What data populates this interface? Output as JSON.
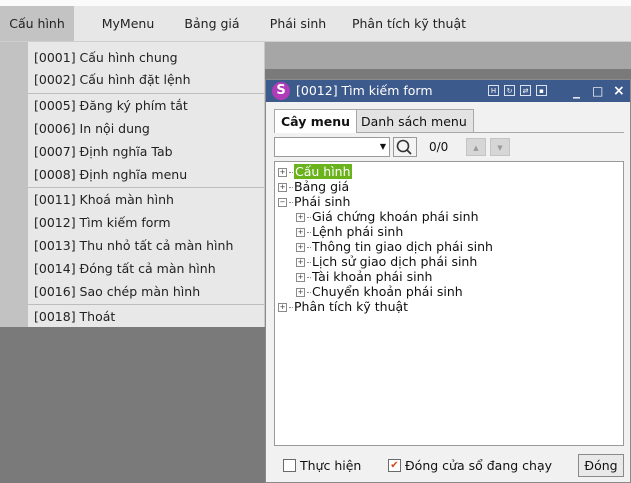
{
  "menubar": {
    "items": [
      {
        "label": "Cấu hình"
      },
      {
        "label": "MyMenu"
      },
      {
        "label": "Bảng giá"
      },
      {
        "label": "Phái sinh"
      },
      {
        "label": "Phân tích kỹ thuật"
      }
    ]
  },
  "dropdown": {
    "items": [
      {
        "label": "[0001] Cấu hình chung"
      },
      {
        "label": "[0002] Cấu hình đặt lệnh"
      },
      {
        "label": "[0005] Đăng ký phím tắt"
      },
      {
        "label": "[0006] In nội dung"
      },
      {
        "label": "[0007] Định nghĩa Tab"
      },
      {
        "label": "[0008] Định nghĩa menu"
      },
      {
        "label": "[0011] Khoá màn hình"
      },
      {
        "label": "[0012] Tìm kiếm form"
      },
      {
        "label": "[0013] Thu nhỏ tất cả màn hình"
      },
      {
        "label": "[0014] Đóng tất cả màn hình"
      },
      {
        "label": "[0016] Sao chép màn hình"
      },
      {
        "label": "[0018] Thoát"
      }
    ]
  },
  "window": {
    "icon_letter": "S",
    "title": "[0012] Tìm kiếm form",
    "minimize": "_",
    "maximize": "□",
    "close": "×",
    "tabs": [
      {
        "label": "Cây menu"
      },
      {
        "label": "Danh sách menu"
      }
    ],
    "search": {
      "count": "0/0"
    },
    "tree": [
      {
        "label": "Cấu hình"
      },
      {
        "label": "Bảng giá"
      },
      {
        "label": "Phái sinh"
      },
      {
        "label": "Giá chứng khoán phái sinh"
      },
      {
        "label": "Lệnh phái sinh"
      },
      {
        "label": "Thông tin giao dịch phái sinh"
      },
      {
        "label": "Lịch sử giao dịch phái sinh"
      },
      {
        "label": "Tài khoản phái sinh"
      },
      {
        "label": "Chuyển khoản phái sinh"
      },
      {
        "label": "Phân tích kỹ thuật"
      }
    ],
    "footer": {
      "execute_label": "Thực hiện",
      "execute_checked": false,
      "close_on_run_label": "Đóng cửa sổ đang chạy",
      "close_on_run_checked": true,
      "close_button": "Đóng"
    }
  },
  "colors": {
    "titlebar": "#3d5a8c",
    "selected_node": "#6ab31d",
    "checkmark": "#d04a1a"
  }
}
